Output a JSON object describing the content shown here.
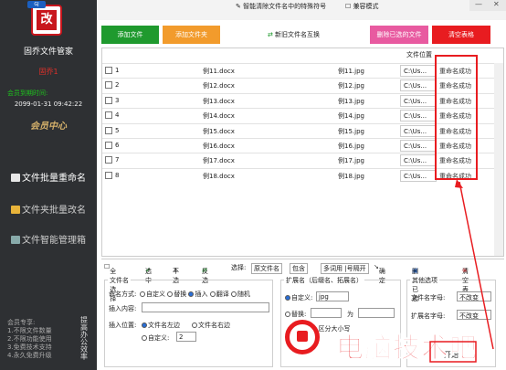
{
  "sidebar": {
    "title": "固乔文件管家",
    "user": "固乔1",
    "expire_label": "会员到期时间:",
    "expire_date": "2099-01-31 09:42:22",
    "vip": "会员中心",
    "nav": [
      "文件批量重命名",
      "文件夹批量改名",
      "文件智能管理箱"
    ],
    "member_lines": [
      "会员专享:",
      "1.不限文件数量",
      "2.不限功能使用",
      "3.免费技术支持",
      "4.永久免费升级"
    ],
    "side_text": "提高办公效率"
  },
  "topbar": {
    "tip": "智能清除文件名中的特殊符号",
    "compat": "兼容模式"
  },
  "buttons": {
    "add_file": "添加文件",
    "add_folder": "添加文件夹",
    "swap": "新旧文件名互换",
    "delete_selected": "删除已选的文件",
    "clear": "清空表格"
  },
  "grid": {
    "header_path": "文件位置",
    "rows": [
      {
        "n": "1",
        "old": "例11.docx",
        "new": "例11.jpg",
        "path": "C:\\Us...",
        "status": "重命名成功"
      },
      {
        "n": "2",
        "old": "例12.docx",
        "new": "例12.jpg",
        "path": "C:\\Us...",
        "status": "重命名成功"
      },
      {
        "n": "3",
        "old": "例13.docx",
        "new": "例13.jpg",
        "path": "C:\\Us...",
        "status": "重命名成功"
      },
      {
        "n": "4",
        "old": "例14.docx",
        "new": "例14.jpg",
        "path": "C:\\Us...",
        "status": "重命名成功"
      },
      {
        "n": "5",
        "old": "例15.docx",
        "new": "例15.jpg",
        "path": "C:\\Us...",
        "status": "重命名成功"
      },
      {
        "n": "6",
        "old": "例16.docx",
        "new": "例16.jpg",
        "path": "C:\\Us...",
        "status": "重命名成功"
      },
      {
        "n": "7",
        "old": "例17.docx",
        "new": "例17.jpg",
        "path": "C:\\Us...",
        "status": "重命名成功"
      },
      {
        "n": "8",
        "old": "例18.docx",
        "new": "例18.jpg",
        "path": "C:\\Us...",
        "status": "重命名成功"
      }
    ]
  },
  "controls": {
    "select_all": "全部选择",
    "select": "选中",
    "deselect": "不选",
    "invert": "反选",
    "select_label": "选择:",
    "field_value": "原文件名",
    "contains_value": "包含",
    "keyword_placeholder": "多词用 |号隔开",
    "confirm": "确定",
    "delete_selected": "删除已选",
    "clear_table": "清空表格"
  },
  "filename": {
    "legend": "文件名",
    "method_label": "命名方式:",
    "methods": [
      "自定义",
      "替换",
      "插入",
      "翻译",
      "随机"
    ],
    "insert_label": "插入内容:",
    "position_label": "插入位置:",
    "pos_left": "文件名左边",
    "pos_right": "文件名右边",
    "custom": "自定义:",
    "custom_value": "2"
  },
  "extension": {
    "legend": "扩展名（后缀名、拓展名）",
    "custom": "自定义:",
    "custom_value": "jpg",
    "replace": "替换:",
    "to": "为",
    "case": "区分大小写"
  },
  "other": {
    "legend": "其他选项",
    "filename_case": "文件名字母:",
    "filename_case_value": "不改变",
    "ext_case": "扩展名字母:",
    "ext_case_value": "不改变",
    "start": "开始"
  },
  "watermark": "电脑技术吧"
}
